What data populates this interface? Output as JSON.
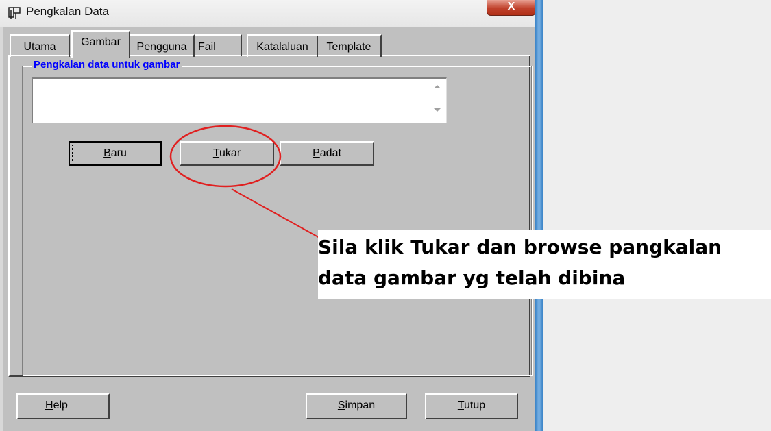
{
  "window": {
    "title": "Pengkalan Data",
    "close_label": "X"
  },
  "tabs": [
    {
      "label": "Utama"
    },
    {
      "label": "Gambar"
    },
    {
      "label": "Pengguna"
    },
    {
      "label": "Fail"
    },
    {
      "label": "Katalaluan"
    },
    {
      "label": "Template"
    }
  ],
  "group": {
    "legend": "Pengkalan data untuk gambar",
    "list_value": ""
  },
  "buttons": {
    "baru": {
      "label": "Baru",
      "mnemonic": "B",
      "rest": "aru"
    },
    "tukar": {
      "label": "Tukar",
      "mnemonic": "T",
      "rest": "ukar"
    },
    "padat": {
      "label": "Padat",
      "mnemonic": "P",
      "rest": "adat"
    },
    "help": {
      "label": "Help",
      "mnemonic": "H",
      "rest": "elp"
    },
    "simpan": {
      "label": "Simpan",
      "mnemonic": "S",
      "rest": "impan"
    },
    "tutup": {
      "label": "Tutup",
      "mnemonic": "T",
      "rest": "utup"
    }
  },
  "annotation": {
    "line1": "Sila klik Tukar dan browse pangkalan",
    "line2": "data gambar yg telah dibina",
    "highlight_color": "#e02020"
  },
  "colors": {
    "window_bg": "#c0c0c0",
    "legend_blue": "#0000ff",
    "frame_blue": "#3a83c7"
  }
}
